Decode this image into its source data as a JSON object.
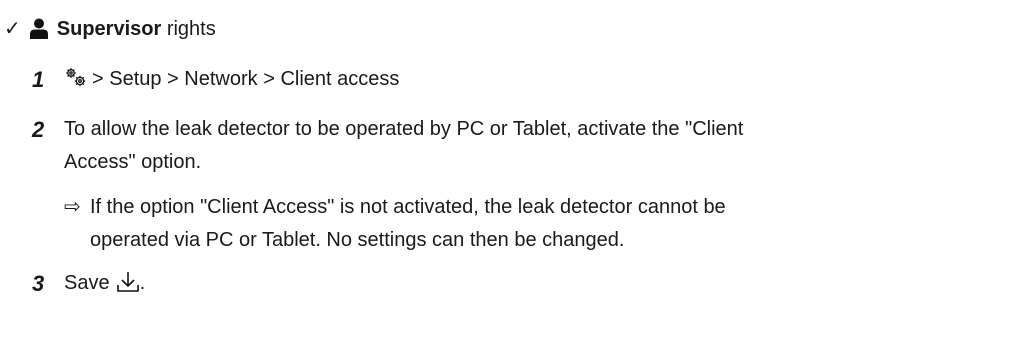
{
  "prerequisite": {
    "check_glyph": "✓",
    "icon": "user-icon",
    "role": "Supervisor",
    "suffix": "rights"
  },
  "steps": [
    {
      "number": "1",
      "icon": "settings-gears-icon",
      "path_text": "> Setup > Network > Client access"
    },
    {
      "number": "2",
      "line1": "To allow the leak detector to be operated by PC or Tablet, activate the \"Client",
      "line2": "Access\" option.",
      "result": {
        "arrow": "⇨",
        "line1": "If the option \"Client Access\" is not activated, the leak detector cannot be",
        "line2": "operated via PC or Tablet. No settings can then be changed."
      }
    },
    {
      "number": "3",
      "text": "Save",
      "icon": "save-download-icon",
      "trailing": "."
    }
  ]
}
